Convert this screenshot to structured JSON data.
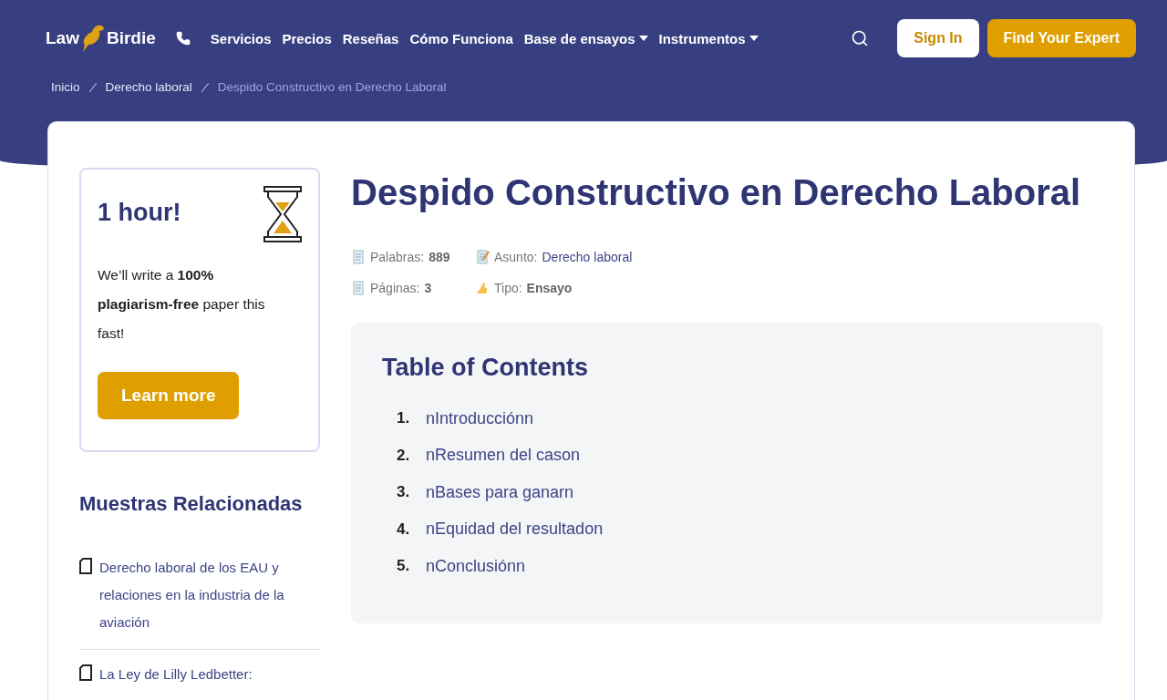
{
  "header": {
    "logo": {
      "left": "Law",
      "right": "Birdie"
    },
    "nav": [
      {
        "label": "Servicios",
        "dropdown": false
      },
      {
        "label": "Precios",
        "dropdown": false
      },
      {
        "label": "Reseñas",
        "dropdown": false
      },
      {
        "label": "Cómo Funciona",
        "dropdown": false
      },
      {
        "label": "Base de ensayos",
        "dropdown": true
      },
      {
        "label": "Instrumentos",
        "dropdown": true
      }
    ],
    "sign_in": "Sign In",
    "cta": "Find Your Expert"
  },
  "breadcrumbs": [
    {
      "label": "Inicio",
      "current": false
    },
    {
      "label": "Derecho laboral",
      "current": false
    },
    {
      "label": "Despido Constructivo en Derecho Laboral",
      "current": true
    }
  ],
  "promo": {
    "title": "1 hour!",
    "text": "We’ll write a **100% plagiarism-free** paper this fast!",
    "button": "Learn more"
  },
  "related": {
    "title": "Muestras Relacionadas",
    "items": [
      "Derecho laboral de los EAU y relaciones en la industria de la aviación",
      "La Ley de Lilly Ledbetter:"
    ]
  },
  "article": {
    "title": "Despido Constructivo en Derecho Laboral",
    "meta": [
      {
        "kind": "words",
        "label": "Palabras:",
        "value": "889",
        "link": false
      },
      {
        "kind": "subject",
        "label": "Asunto:",
        "value": "Derecho laboral",
        "link": true
      },
      {
        "kind": "pages",
        "label": "Páginas:",
        "value": "3",
        "link": false
      },
      {
        "kind": "type",
        "label": "Tipo:",
        "value": "Ensayo",
        "link": false
      }
    ],
    "toc": {
      "title": "Table of Contents",
      "items": [
        {
          "number": "1.",
          "label": "nIntroducciónn"
        },
        {
          "number": "2.",
          "label": "nResumen del cason"
        },
        {
          "number": "3.",
          "label": "nBases para ganarn"
        },
        {
          "number": "4.",
          "label": "nEquidad del resultadon"
        },
        {
          "number": "5.",
          "label": "nConclusiónn"
        }
      ]
    }
  }
}
